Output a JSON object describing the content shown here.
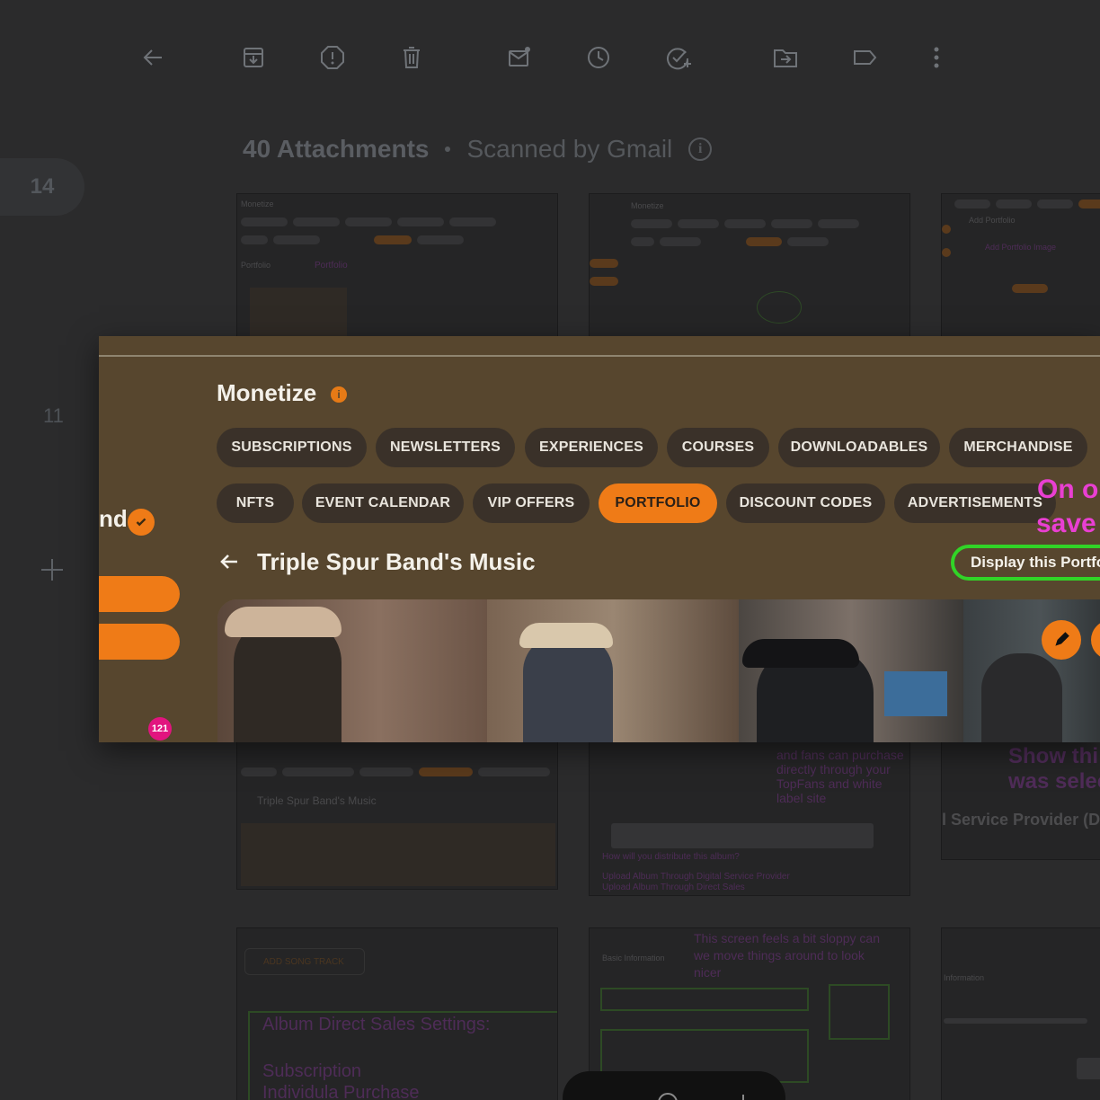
{
  "toolbar": {
    "icons": [
      "back-arrow-icon",
      "archive-icon",
      "report-spam-icon",
      "delete-icon",
      "mark-unread-icon",
      "snooze-icon",
      "add-to-tasks-icon",
      "move-to-icon",
      "label-icon",
      "more-vert-icon"
    ]
  },
  "left_strip": {
    "count": "14",
    "secondary": "11"
  },
  "header": {
    "title": "40 Attachments",
    "subtitle": "Scanned by Gmail"
  },
  "modal": {
    "title": "Monetize",
    "info_icon": "i",
    "tabs_row1": [
      "SUBSCRIPTIONS",
      "NEWSLETTERS",
      "EXPERIENCES",
      "COURSES",
      "DOWNLOADABLES",
      "MERCHANDISE"
    ],
    "tabs_row2": [
      "NFTS",
      "EVENT CALENDAR",
      "VIP OFFERS",
      "PORTFOLIO",
      "DISCOUNT CODES",
      "ADVERTISEMENTS"
    ],
    "active_tab": "PORTFOLIO",
    "annotation_line1": "On o",
    "annotation_line2": "save",
    "portfolio_title": "Triple Spur Band's Music",
    "display_button": "Display this Portfo",
    "left_partial_name": "nd",
    "notification_count": "121",
    "accent_color": "#ef7b17",
    "annotation_color": "#e93fd2",
    "highlight_color": "#31d427"
  },
  "thumbnails": {
    "t1": {
      "title": "Monetize",
      "sub": "Portfolio",
      "annot": "Portfolio"
    },
    "t4": {
      "title": "Triple Spur Band's Music",
      "tabs": [
        "NFTS",
        "EVENT CALENDAR",
        "VIP OFFERS",
        "PORTFOLIO",
        "DISCOUNT CODE"
      ]
    },
    "t5": {
      "annot": "and fans can purchase directly through your TopFans and white label site",
      "link1": "How will you distribute this album?",
      "link2": "Upload Album Through Digital Service Provider",
      "link3": "Upload Album Through Direct Sales"
    },
    "t6": {
      "annot1": "Show thi",
      "annot2": "was selec",
      "text": "l Service Provider (D"
    },
    "t7": {
      "button": "ADD SONG TRACK",
      "annot1": "Album Direct Sales Settings:",
      "annot2": "Subscription",
      "annot3": "Individula Purchase"
    },
    "t8": {
      "annot": "This screen feels a bit sloppy can we move things around to look nicer",
      "label": "Basic Information"
    },
    "t9": {
      "label": "Information"
    },
    "t3": {
      "title": "Add Portfolio",
      "annot": "Add Portfolio Image"
    }
  }
}
